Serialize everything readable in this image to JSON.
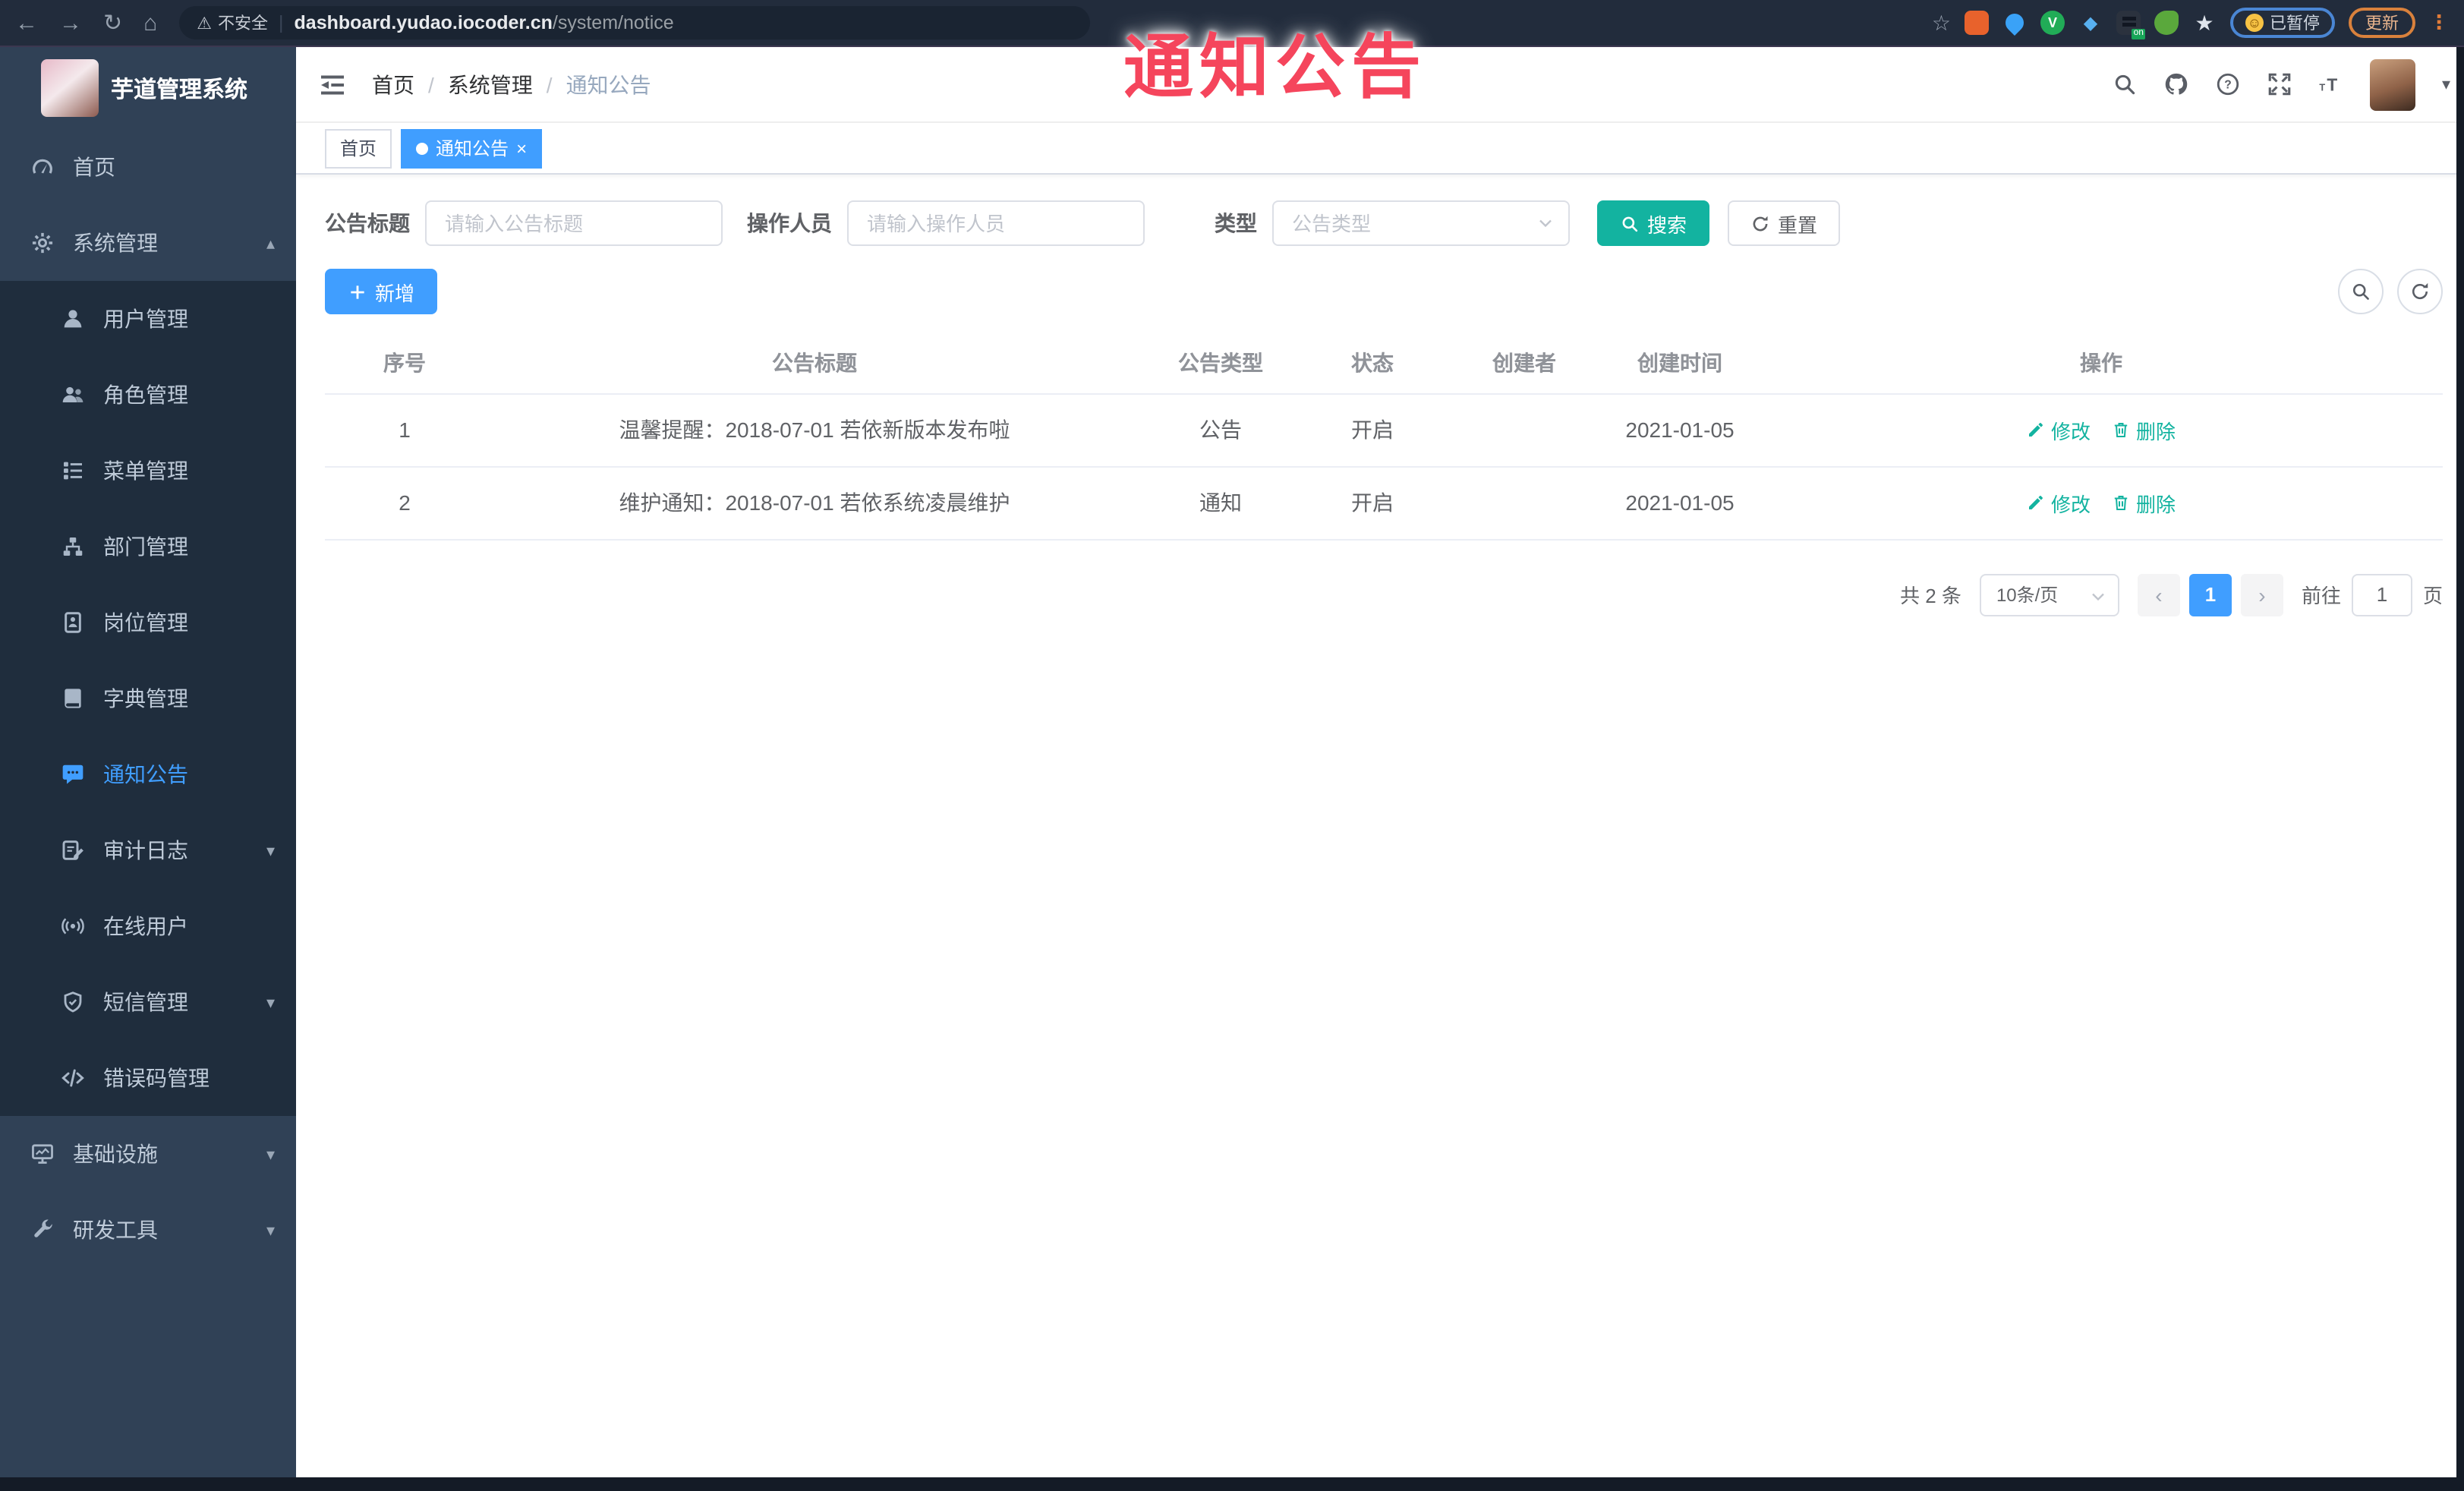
{
  "colors": {
    "primary": "#409eff",
    "teal": "#13b3a0",
    "overlay_red": "#f5455c",
    "sidebar_bg": "#304156",
    "submenu_bg": "#1f2d3d"
  },
  "overlay_title": "通知公告",
  "browser": {
    "security_warning": "不安全",
    "url_host": "dashboard.yudao.iocoder.cn",
    "url_path": "/system/notice",
    "extensions": [
      "bookmark-star-icon",
      "ext-orange-icon",
      "ext-pin-icon",
      "ext-green-icon",
      "ext-gem-icon",
      "ext-onbadge-icon",
      "ext-leaf-icon",
      "ext-ghost-icon"
    ],
    "green_icon_letter": "V",
    "on_badge": "on",
    "paused_badge": "已暂停",
    "update_button": "更新"
  },
  "sidebar": {
    "logo_title": "芋道管理系统",
    "menu": [
      {
        "label": "首页",
        "icon": "dashboard-icon",
        "level": 1
      },
      {
        "label": "系统管理",
        "icon": "gear-icon",
        "level": 1,
        "arrow": "up"
      },
      {
        "label": "用户管理",
        "icon": "user-icon",
        "level": 2
      },
      {
        "label": "角色管理",
        "icon": "role-icon",
        "level": 2
      },
      {
        "label": "菜单管理",
        "icon": "menu-list-icon",
        "level": 2
      },
      {
        "label": "部门管理",
        "icon": "org-icon",
        "level": 2
      },
      {
        "label": "岗位管理",
        "icon": "badge-icon",
        "level": 2
      },
      {
        "label": "字典管理",
        "icon": "dict-icon",
        "level": 2
      },
      {
        "label": "通知公告",
        "icon": "notice-icon",
        "level": 2,
        "active": true
      },
      {
        "label": "审计日志",
        "icon": "log-icon",
        "level": 2,
        "arrow": "down"
      },
      {
        "label": "在线用户",
        "icon": "online-icon",
        "level": 2
      },
      {
        "label": "短信管理",
        "icon": "shield-icon",
        "level": 2,
        "arrow": "down"
      },
      {
        "label": "错误码管理",
        "icon": "code-icon",
        "level": 2
      },
      {
        "label": "基础设施",
        "icon": "infra-icon",
        "level": 1,
        "arrow": "down"
      },
      {
        "label": "研发工具",
        "icon": "devtool-icon",
        "level": 1,
        "arrow": "down"
      }
    ]
  },
  "navbar": {
    "breadcrumb": [
      "首页",
      "系统管理",
      "通知公告"
    ]
  },
  "tags": [
    {
      "label": "首页"
    },
    {
      "label": "通知公告",
      "active": true,
      "closable": true
    }
  ],
  "filters": {
    "title_label": "公告标题",
    "title_placeholder": "请输入公告标题",
    "operator_label": "操作人员",
    "operator_placeholder": "请输入操作人员",
    "type_label": "类型",
    "type_placeholder": "公告类型",
    "search_label": "搜索",
    "reset_label": "重置"
  },
  "toolbar": {
    "add_label": "新增"
  },
  "table": {
    "columns": [
      "序号",
      "公告标题",
      "公告类型",
      "状态",
      "创建者",
      "创建时间",
      "操作"
    ],
    "rows": [
      {
        "index": "1",
        "title": "温馨提醒：2018-07-01 若依新版本发布啦",
        "type": "公告",
        "status": "开启",
        "creator": "",
        "create_time": "2021-01-05"
      },
      {
        "index": "2",
        "title": "维护通知：2018-07-01 若依系统凌晨维护",
        "type": "通知",
        "status": "开启",
        "creator": "",
        "create_time": "2021-01-05"
      }
    ],
    "edit_label": "修改",
    "delete_label": "删除"
  },
  "pagination": {
    "total_text": "共 2 条",
    "page_size": "10条/页",
    "current_page": "1",
    "goto_label": "前往",
    "goto_value": "1",
    "page_unit": "页"
  }
}
